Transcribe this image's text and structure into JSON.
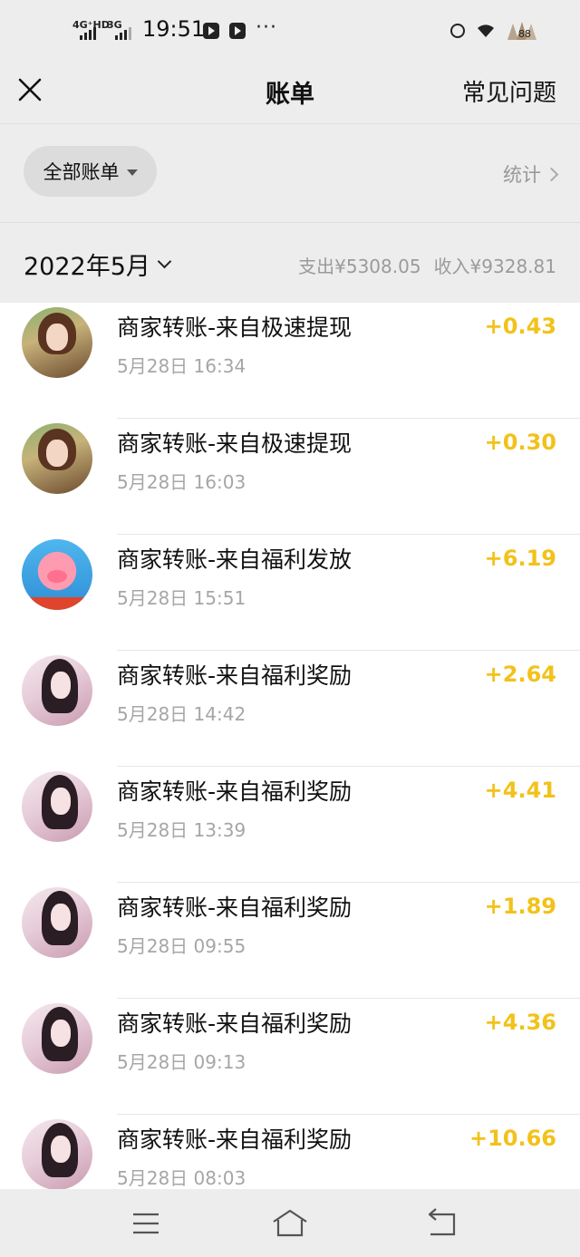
{
  "status_bar": {
    "network_1": "4G⁺HD",
    "network_2": "3G",
    "time": "19:51",
    "more": "···",
    "battery": "88"
  },
  "header": {
    "title": "账单",
    "faq": "常见问题"
  },
  "filter": {
    "label": "全部账单",
    "stats": "统计"
  },
  "month": {
    "label": "2022年5月",
    "expense": "支出¥5308.05",
    "income": "收入¥9328.81"
  },
  "transactions": [
    {
      "title": "商家转账-来自极速提现",
      "time": "5月28日 16:34",
      "amount": "+0.43",
      "avatar": "girl"
    },
    {
      "title": "商家转账-来自极速提现",
      "time": "5月28日 16:03",
      "amount": "+0.30",
      "avatar": "girl"
    },
    {
      "title": "商家转账-来自福利发放",
      "time": "5月28日 15:51",
      "amount": "+6.19",
      "avatar": "pig"
    },
    {
      "title": "商家转账-来自福利奖励",
      "time": "5月28日 14:42",
      "amount": "+2.64",
      "avatar": "lady"
    },
    {
      "title": "商家转账-来自福利奖励",
      "time": "5月28日 13:39",
      "amount": "+4.41",
      "avatar": "lady"
    },
    {
      "title": "商家转账-来自福利奖励",
      "time": "5月28日 09:55",
      "amount": "+1.89",
      "avatar": "lady"
    },
    {
      "title": "商家转账-来自福利奖励",
      "time": "5月28日 09:13",
      "amount": "+4.36",
      "avatar": "lady"
    },
    {
      "title": "商家转账-来自福利奖励",
      "time": "5月28日 08:03",
      "amount": "+10.66",
      "avatar": "lady"
    }
  ],
  "colors": {
    "accent_income": "#f2c21b",
    "background": "#ededed"
  },
  "icons": {
    "close": "close-icon",
    "menu": "menu-icon",
    "home": "home-icon",
    "back": "back-icon"
  }
}
